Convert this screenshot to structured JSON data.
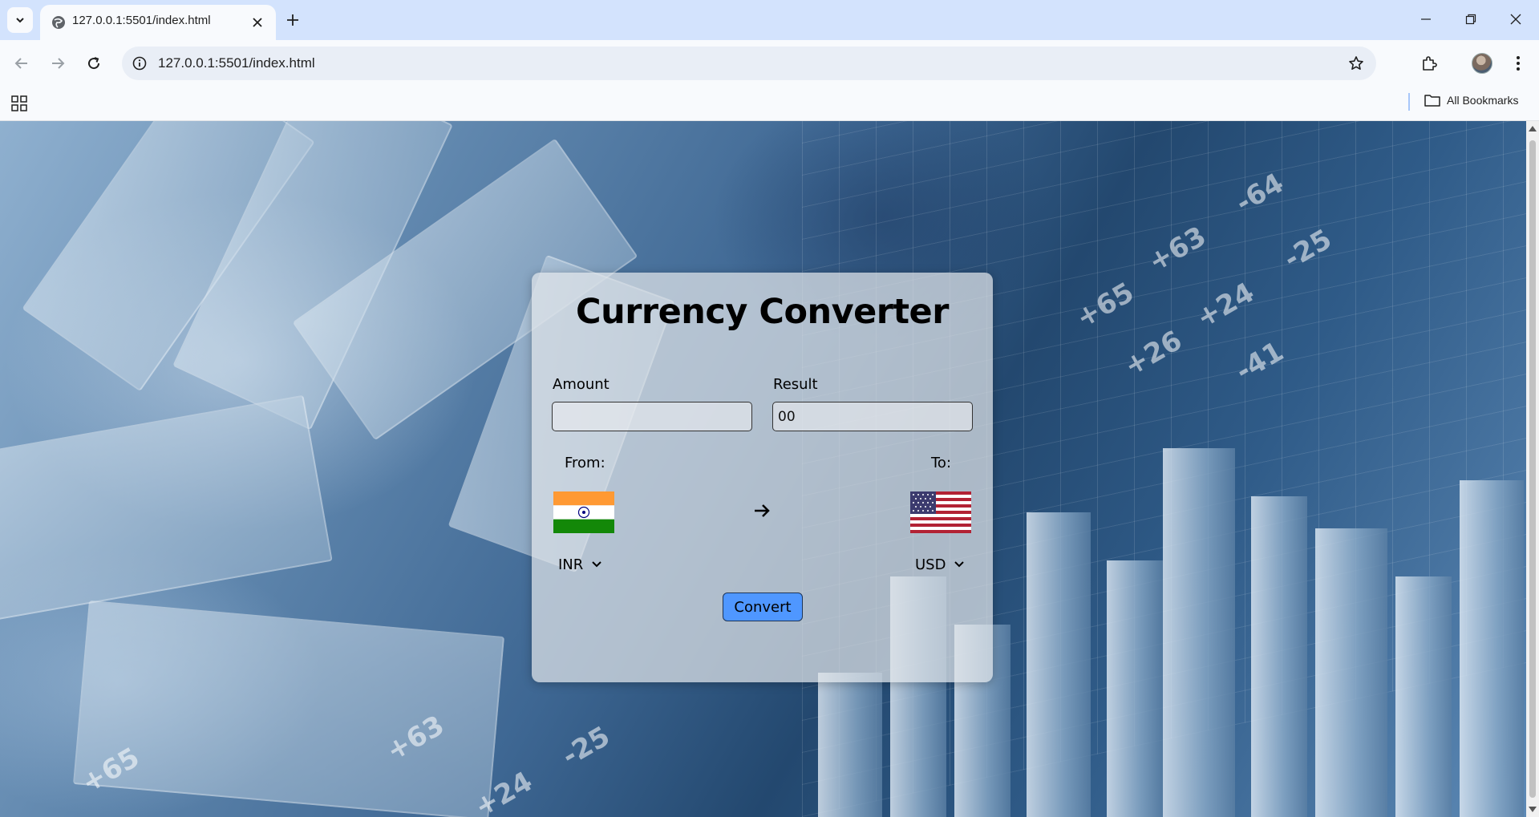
{
  "browser": {
    "tab_title": "127.0.0.1:5501/index.html",
    "url": "127.0.0.1:5501/index.html",
    "bookmarks_label": "All Bookmarks"
  },
  "background_numbers": [
    "+65",
    "-64",
    "+63",
    "-25",
    "+24",
    "+26",
    "-41",
    "+65",
    "+63",
    "-25",
    "+24"
  ],
  "app": {
    "title": "Currency Converter",
    "amount_label": "Amount",
    "amount_value": "",
    "result_label": "Result",
    "result_value": "00",
    "from_label": "From:",
    "to_label": "To:",
    "from_currency": "INR",
    "to_currency": "USD",
    "convert_label": "Convert"
  },
  "colors": {
    "convert_button": "#4f97ff",
    "card_background": "rgba(225,228,233,0.72)"
  },
  "icons": {
    "from_flag": "india-flag-icon",
    "to_flag": "usa-flag-icon",
    "arrow": "arrow-right-icon"
  }
}
